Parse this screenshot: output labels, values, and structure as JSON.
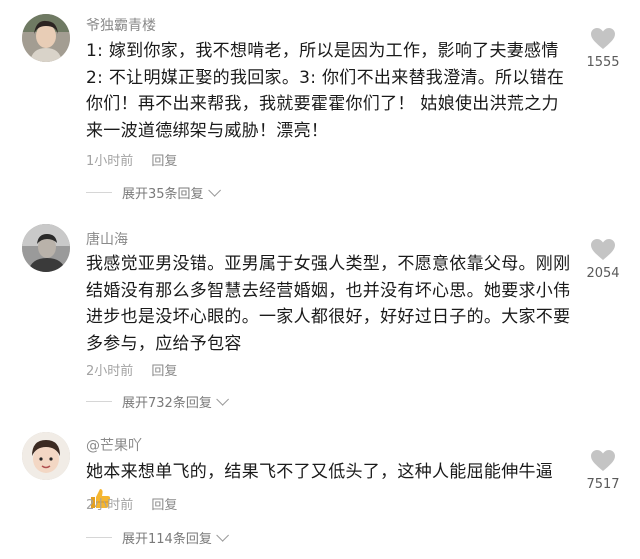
{
  "comments": [
    {
      "username": "爷独霸青楼",
      "text": "1: 嫁到你家，我不想啃老，所以是因为工作，影响了夫妻感情2: 不让明媒正娶的我回家。3: 你们不出来替我澄清。所以错在你们！再不出来帮我，我就要霍霍你们了！ 姑娘使出洪荒之力来一波道德绑架与威胁！漂亮！",
      "time": "1小时前",
      "reply_label": "回复",
      "expand_label": "展开35条回复",
      "like_count": "1555",
      "avatar_icon": "avatar-girl-icon"
    },
    {
      "username": "唐山海",
      "text": "我感觉亚男没错。亚男属于女强人类型，不愿意依靠父母。刚刚结婚没有那么多智慧去经营婚姻，也并没有坏心思。她要求小伟进步也是没坏心眼的。一家人都很好，好好过日子的。大家不要多参与，应给予包容",
      "time": "2小时前",
      "reply_label": "回复",
      "expand_label": "展开732条回复",
      "like_count": "2054",
      "avatar_icon": "avatar-man-icon"
    },
    {
      "username": "@芒果吖",
      "text": "她本来想单飞的，结果飞不了又低头了，这种人能屈能伸牛逼",
      "time": "2小时前",
      "reply_label": "回复",
      "expand_label": "展开114条回复",
      "like_count": "7517",
      "avatar_icon": "avatar-child-icon",
      "trailing_emoji": "thumbs-up-icon"
    }
  ],
  "colors": {
    "text": "#1a1a1a",
    "username": "#8a8a8a",
    "meta": "#a3a3a3",
    "heart": "#c4c4c4",
    "thumb": "#f5b630"
  },
  "icons": {
    "like": "heart-icon",
    "expand": "chevron-down-icon"
  }
}
